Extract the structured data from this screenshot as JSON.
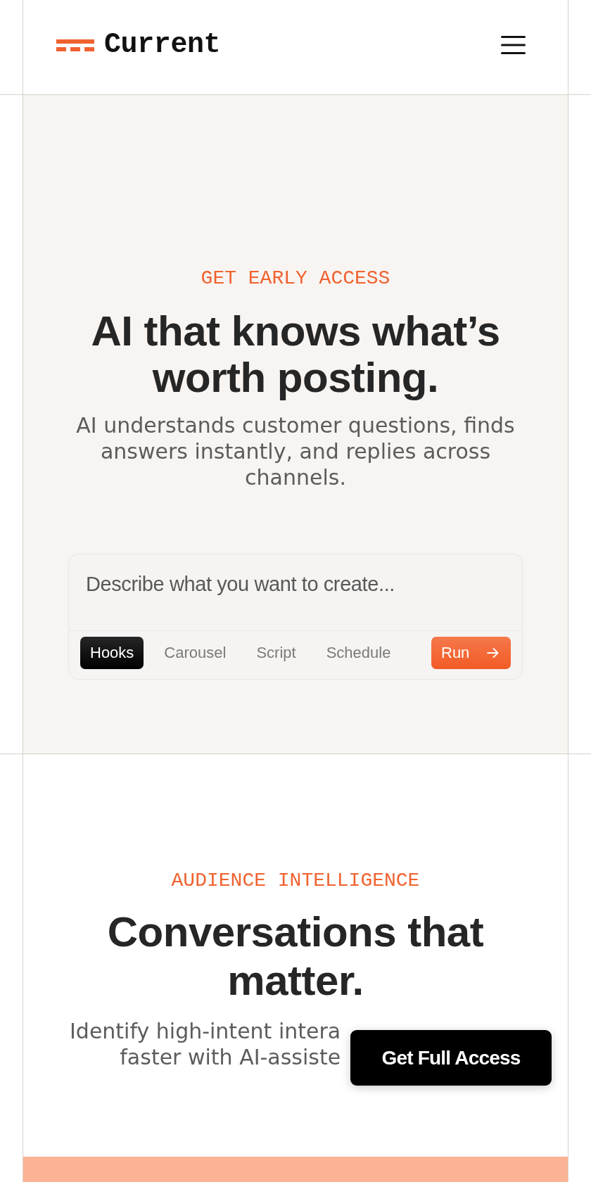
{
  "header": {
    "brand": "Current"
  },
  "hero": {
    "eyebrow": "GET EARLY ACCESS",
    "title": "AI that knows what’s worth posting.",
    "subtitle": "AI understands customer questions, finds answers instantly, and replies across channels.",
    "composer": {
      "placeholder": "Describe what you want to create...",
      "modes": [
        {
          "label": "Hooks",
          "selected": true
        },
        {
          "label": "Carousel",
          "selected": false
        },
        {
          "label": "Script",
          "selected": false
        },
        {
          "label": "Schedule",
          "selected": false
        }
      ],
      "submit": "Run"
    }
  },
  "features": {
    "eyebrow": "AUDIENCE INTELLIGENCE",
    "title": "Conversations that matter.",
    "description_lines": [
      "Identify high-intent intera",
      "faster with AI-assiste"
    ]
  },
  "floating_button": {
    "label": "Get Full Access"
  }
}
